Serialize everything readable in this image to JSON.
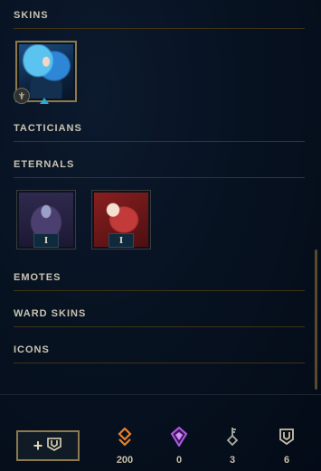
{
  "sections": {
    "skins": "SKINS",
    "tacticians": "TACTICIANS",
    "eternals": "ETERNALS",
    "emotes": "EMOTES",
    "ward_skins": "WARD SKINS",
    "icons": "ICONS"
  },
  "eternals": [
    {
      "badge": "I"
    },
    {
      "badge": "I"
    }
  ],
  "footer": {
    "currencies": [
      {
        "name": "orange-essence",
        "value": "200",
        "color": "#e9802a"
      },
      {
        "name": "mythic-essence",
        "value": "0",
        "color": "#b35be6"
      },
      {
        "name": "key-fragment",
        "value": "3",
        "color": "#b0aca0"
      },
      {
        "name": "loot-chest",
        "value": "6",
        "color": "#c8c0a8"
      }
    ]
  }
}
